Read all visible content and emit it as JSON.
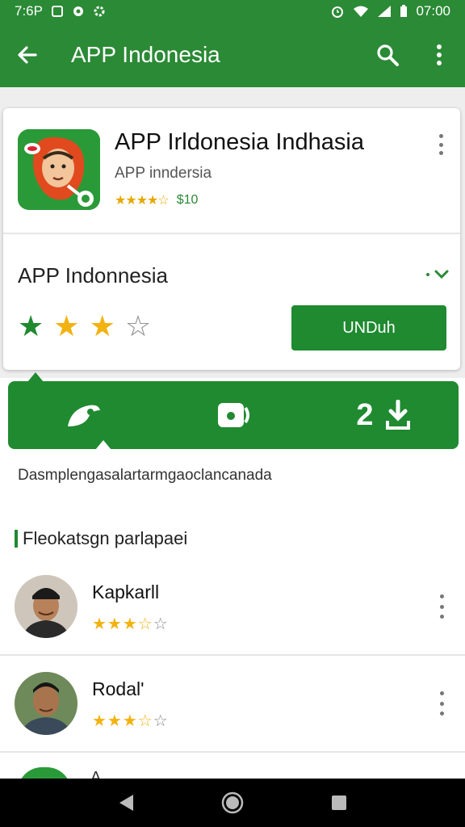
{
  "status_bar": {
    "left_text": "7:6P",
    "time": "07:00"
  },
  "app_bar": {
    "title": "APP Indonesia",
    "icons": [
      "back-arrow-icon",
      "search-icon",
      "overflow-menu-icon"
    ]
  },
  "app_card": {
    "title": "APP Irldonesia Indhasia",
    "developer": "APP inndersia",
    "small_rating_stars": "★★★★☆",
    "price": "$10",
    "app_name": "APP Indonnesia",
    "rating": {
      "filled": 3,
      "total": 4
    },
    "install_label": "UNDuh"
  },
  "colors": {
    "brand_green": "#2b8a35",
    "button_green": "#1f8a30",
    "star_gold": "#f2b20f",
    "star_green": "#1f8a30"
  },
  "tabs": [
    {
      "icon": "leaf-icon"
    },
    {
      "icon": "camera-icon"
    },
    {
      "icon": "download-icon",
      "label": "2"
    }
  ],
  "description": "Dasmplengasalartarmgaoclancanada",
  "reviews_section": {
    "title": "Fleokatsgn parlapaei"
  },
  "reviews": [
    {
      "name": "Kapkarll",
      "stars": "★★★☆"
    },
    {
      "name": "Rodal'",
      "stars": "★★★☆"
    }
  ],
  "peek": {
    "name": "A..."
  },
  "nav_bar": {
    "icons": [
      "nav-back-icon",
      "nav-home-icon",
      "nav-recents-icon"
    ]
  }
}
